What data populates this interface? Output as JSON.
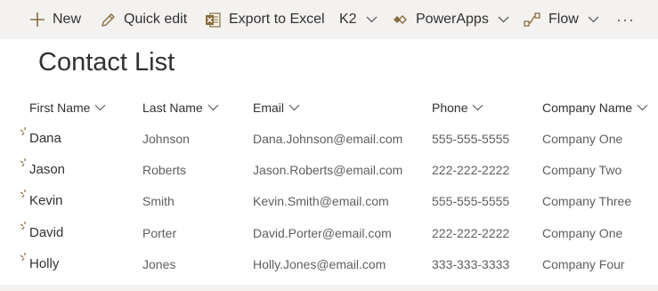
{
  "command_bar": {
    "new_label": "New",
    "quick_edit_label": "Quick edit",
    "export_label": "Export to Excel",
    "k2_label": "K2",
    "powerapps_label": "PowerApps",
    "flow_label": "Flow",
    "more_label": "···"
  },
  "list": {
    "title": "Contact List",
    "columns": {
      "first_name": "First Name",
      "last_name": "Last Name",
      "email": "Email",
      "phone": "Phone",
      "company": "Company Name"
    },
    "rows": [
      {
        "first_name": "Dana",
        "last_name": "Johnson",
        "email": "Dana.Johnson@email.com",
        "phone": "555-555-5555",
        "company": "Company One"
      },
      {
        "first_name": "Jason",
        "last_name": "Roberts",
        "email": "Jason.Roberts@email.com",
        "phone": "222-222-2222",
        "company": "Company Two"
      },
      {
        "first_name": "Kevin",
        "last_name": "Smith",
        "email": "Kevin.Smith@email.com",
        "phone": "555-555-5555",
        "company": "Company Three"
      },
      {
        "first_name": "David",
        "last_name": "Porter",
        "email": "David.Porter@email.com",
        "phone": "222-222-2222",
        "company": "Company One"
      },
      {
        "first_name": "Holly",
        "last_name": "Jones",
        "email": "Holly.Jones@email.com",
        "phone": "333-333-3333",
        "company": "Company Four"
      }
    ]
  },
  "colors": {
    "accent": "#8a6d3b",
    "command_bar_bg": "#f3f2f1",
    "text": "#323130",
    "secondary_text": "#605e5c"
  }
}
